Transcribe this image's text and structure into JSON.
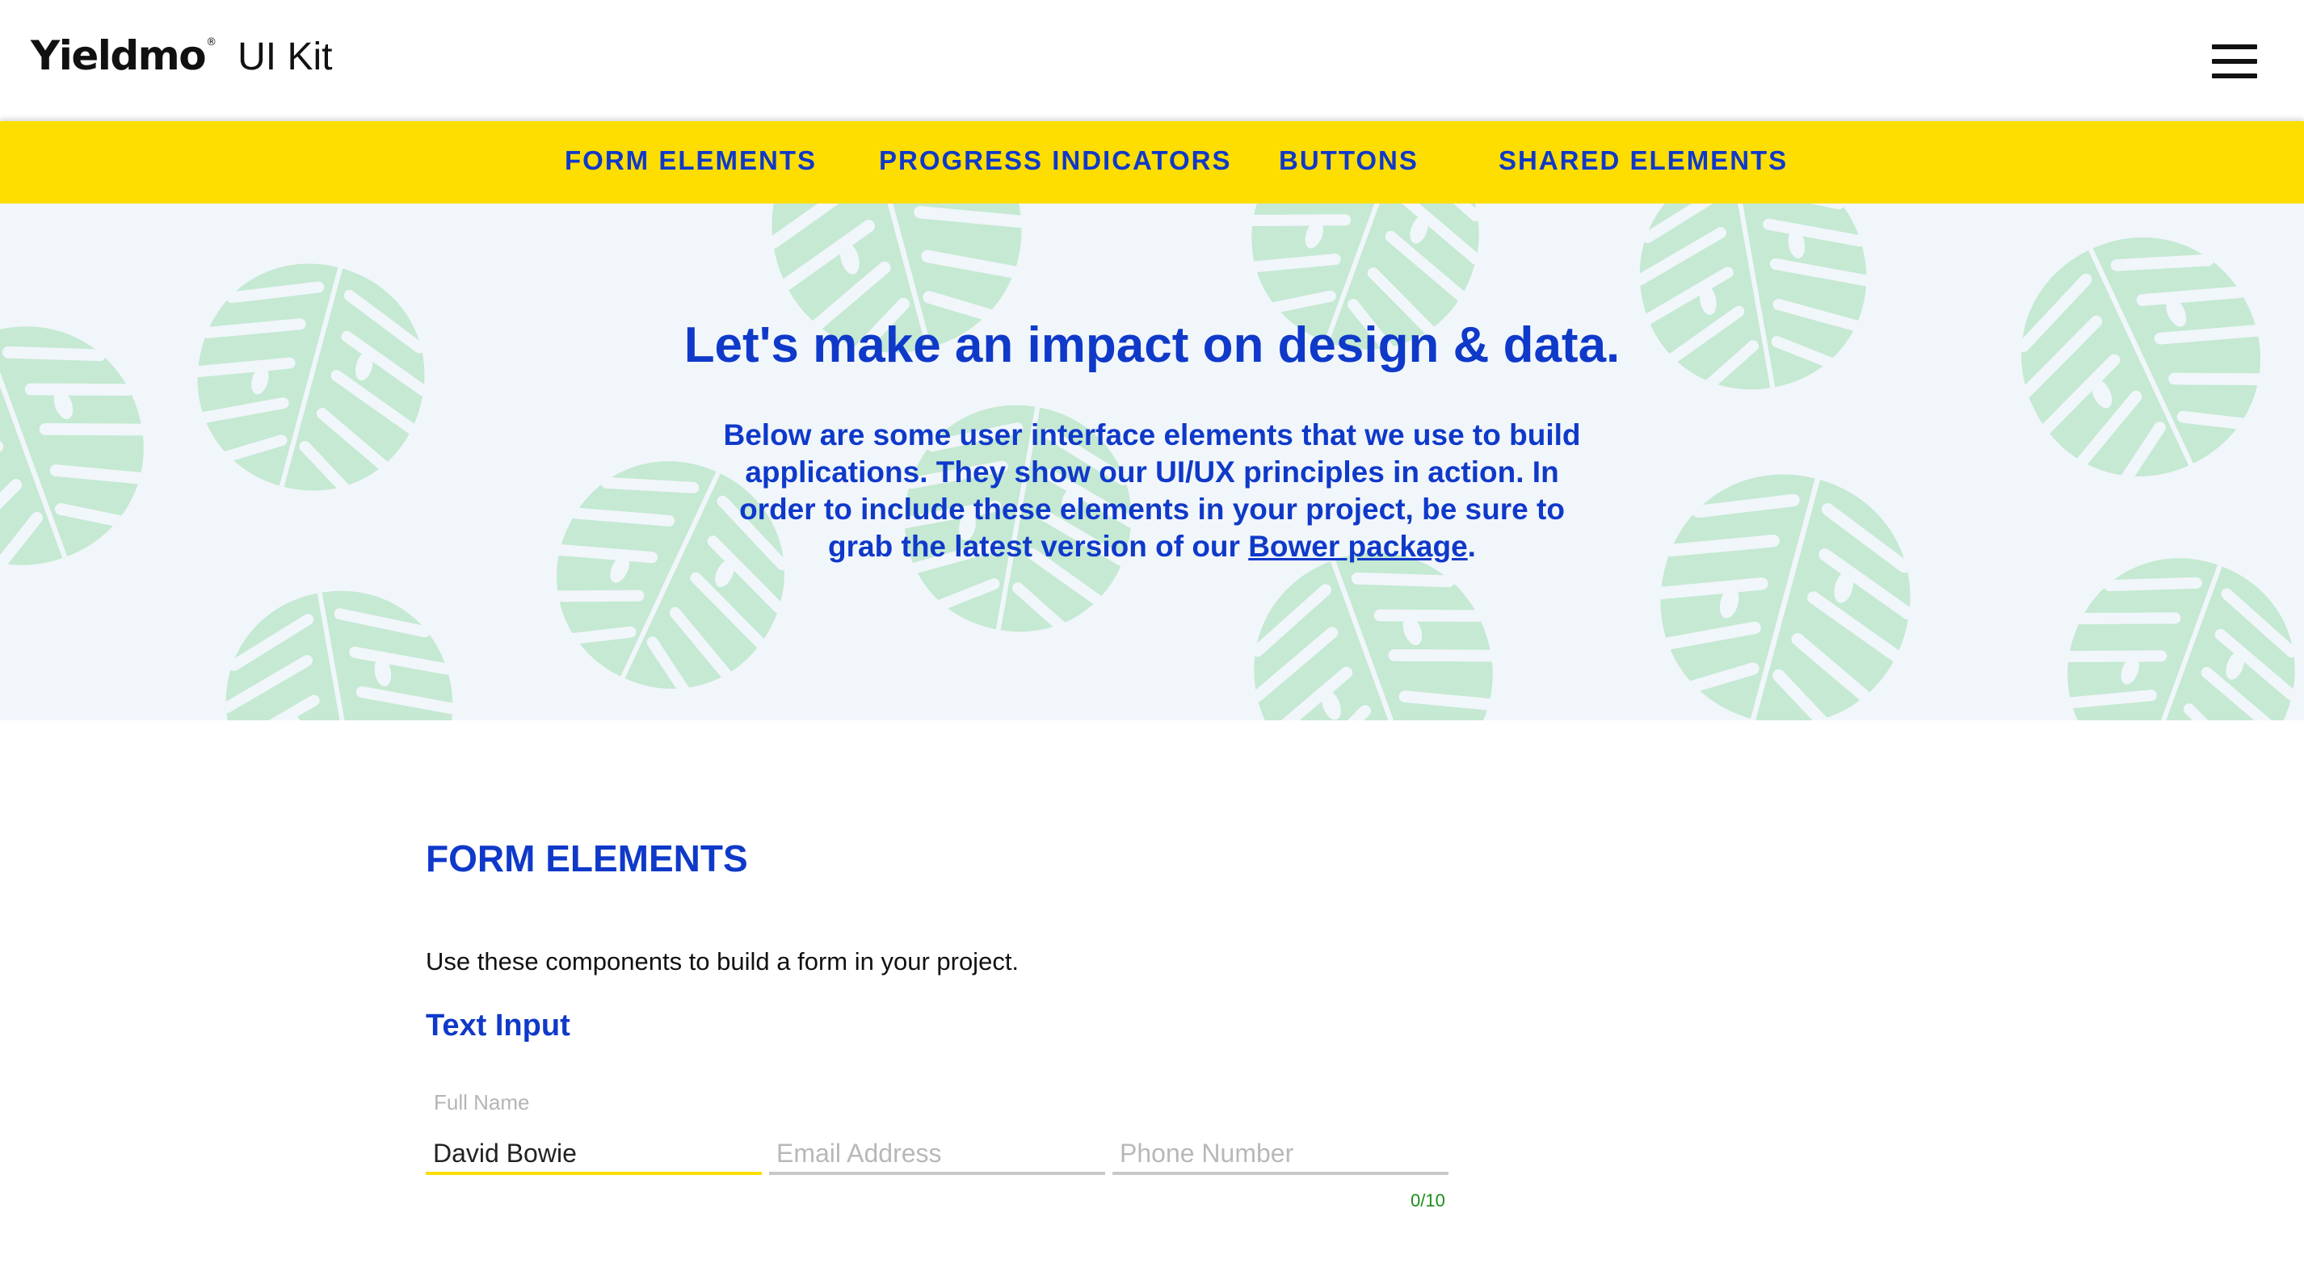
{
  "header": {
    "logo_text": "Yieldmo",
    "logo_mark": "®",
    "subtitle": "UI Kit",
    "menu_icon": "hamburger-menu-icon"
  },
  "nav": {
    "items": [
      {
        "label": "FORM ELEMENTS"
      },
      {
        "label": "PROGRESS INDICATORS"
      },
      {
        "label": "BUTTONS"
      },
      {
        "label": "SHARED ELEMENTS"
      }
    ]
  },
  "hero": {
    "title": "Let's make an impact on design & data.",
    "body_before_link": "Below are some user interface elements that we use to build applications. They show our UI/UX principles in action. In order to include these elements in your project, be sure to grab the latest version of our ",
    "link_label": "Bower package",
    "body_after_link": ".",
    "background_pattern": "monstera-leaf-pattern"
  },
  "main": {
    "section_title": "FORM ELEMENTS",
    "section_desc": "Use these components to build a form in your project.",
    "subsection_title": "Text Input",
    "fields": [
      {
        "label": "Full Name",
        "value": "David Bowie",
        "placeholder": ""
      },
      {
        "label": "",
        "value": "",
        "placeholder": "Email Address"
      },
      {
        "label": "",
        "value": "",
        "placeholder": "Phone Number"
      }
    ],
    "phone_counter": "0/10"
  },
  "colors": {
    "brand_blue": "#0f39c9",
    "nav_yellow": "#fedd00",
    "hero_bg": "#f1f6fb",
    "leaf_green": "#c5e9d2",
    "counter_green": "#1a8d1a"
  }
}
